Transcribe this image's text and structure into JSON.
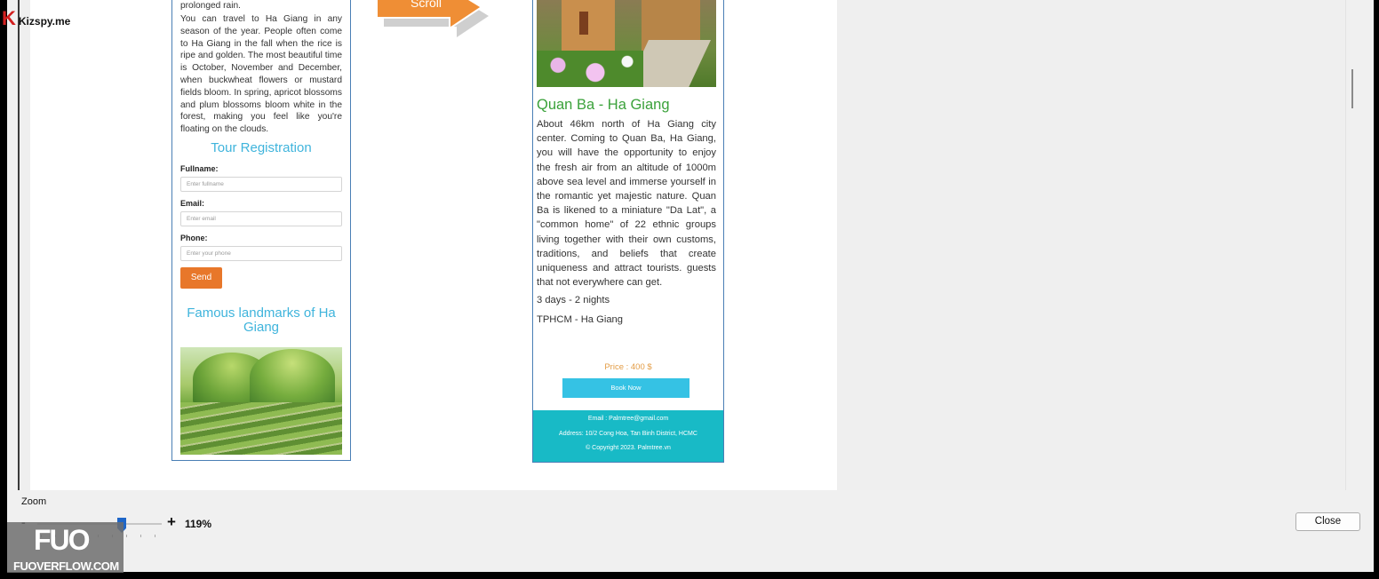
{
  "logo": {
    "letter": "K",
    "text": "Kizspy.me"
  },
  "left_column": {
    "intro_tail": "prolonged rain.",
    "season_text": "You can travel to Ha Giang in any season of the year. People often come to Ha Giang in the fall when the rice is ripe and golden. The most beautiful time is October, November and December, when buckwheat flowers or mustard fields bloom. In spring, apricot blossoms and plum blossoms bloom white in the forest, making you feel like you're floating on the clouds.",
    "form_title": "Tour Registration",
    "fullname_label": "Fullname:",
    "fullname_placeholder": "Enter fullname",
    "email_label": "Email:",
    "email_placeholder": "Enter email",
    "phone_label": "Phone:",
    "phone_placeholder": "Enter your phone",
    "send_label": "Send",
    "landmarks_title": "Famous landmarks of Ha Giang"
  },
  "scroll_arrow": {
    "label": "Scroll"
  },
  "right_column": {
    "place_title": "Quan Ba - Ha Giang",
    "description": "About 46km north of Ha Giang city center. Coming to Quan Ba, Ha Giang, you will have the opportunity to enjoy the fresh air from an altitude of 1000m above sea level and immerse yourself in the romantic yet majestic nature. Quan Ba is likened to a miniature \"Da Lat\", a \"common home\" of 22 ethnic groups living together with their own customs, traditions, and beliefs that create uniqueness and attract tourists. guests that not everywhere can get.",
    "duration": "3 days - 2 nights",
    "route": "TPHCM - Ha Giang",
    "price": "Price : 400 $",
    "book_label": "Book Now",
    "footer_email": "Email : Palmtree@gmail.com",
    "footer_address": "Address: 10/2 Cong Hoa, Tan Binh District, HCMC",
    "footer_copyright": "© Copyright 2023. Palmtree.vn"
  },
  "zoom": {
    "label": "Zoom",
    "minus": "-",
    "plus": "+",
    "value": "119%",
    "level": 119
  },
  "close_label": "Close",
  "watermark": {
    "big": "FUO",
    "small": "FUOVERFLOW.COM"
  },
  "colors": {
    "accent_orange": "#e8772a",
    "book_blue": "#35c2e4",
    "footer_teal": "#18bac6",
    "title_green": "#3aa13a",
    "title_blue": "#3fb4dc"
  }
}
